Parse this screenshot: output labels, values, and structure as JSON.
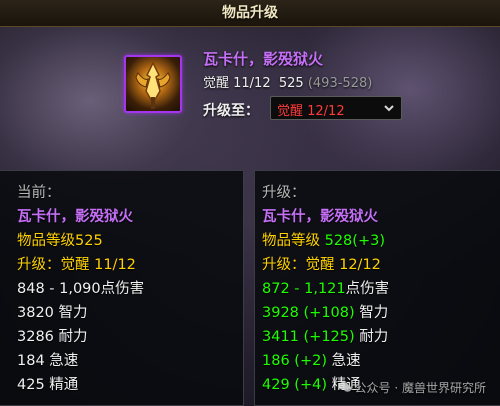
{
  "window": {
    "title": "物品升级"
  },
  "item": {
    "name": "瓦卡什，影殁狱火",
    "icon": "axe-weapon-icon",
    "track": "觉醒 11/12",
    "item_level": "525",
    "ilvl_range": "(493-528)",
    "quality_color": "#a335ee"
  },
  "upgrade_to": {
    "label": "升级至：",
    "selected": "觉醒 12/12"
  },
  "current": {
    "header": "当前：",
    "name": "瓦卡什，影殁狱火",
    "ilvl_label": "物品等级",
    "ilvl": "525",
    "upgrade_label": "升级：",
    "upgrade_value": "觉醒 11/12",
    "damage": "848 - 1,090",
    "damage_suffix": "点伤害",
    "intellect_value": "3820",
    "intellect_label": "智力",
    "stamina_value": "3286",
    "stamina_label": "耐力",
    "haste_value": "184",
    "haste_label": "急速",
    "mastery_value": "425",
    "mastery_label": "精通"
  },
  "upgraded": {
    "header": "升级：",
    "name": "瓦卡什，影殁狱火",
    "ilvl_label": "物品等级",
    "ilvl": "528(+3)",
    "upgrade_label": "升级：",
    "upgrade_value": "觉醒 12/12",
    "damage": "872 - 1,121",
    "damage_suffix": "点伤害",
    "intellect_value": "3928 (+108)",
    "intellect_label": "智力",
    "stamina_value": "3411 (+125)",
    "stamina_label": "耐力",
    "haste_value": "186 (+2)",
    "haste_label": "急速",
    "mastery_value": "429 (+4)",
    "mastery_label": "精通"
  },
  "watermark": {
    "text": "公众号 · 魔兽世界研究所",
    "icon": "wechat-icon"
  },
  "colors": {
    "epic": "#c46ff5",
    "label_yellow": "#ffd200",
    "bonus_green": "#1eff00",
    "selected_red": "#ff3a3a"
  }
}
